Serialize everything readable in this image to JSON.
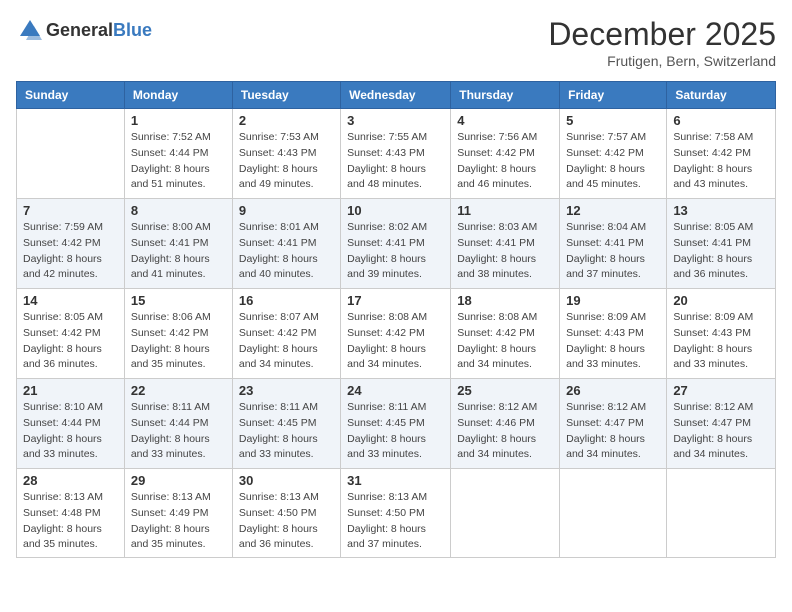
{
  "header": {
    "logo_general": "General",
    "logo_blue": "Blue",
    "month": "December 2025",
    "location": "Frutigen, Bern, Switzerland"
  },
  "days_of_week": [
    "Sunday",
    "Monday",
    "Tuesday",
    "Wednesday",
    "Thursday",
    "Friday",
    "Saturday"
  ],
  "weeks": [
    [
      {
        "day": null,
        "sunrise": null,
        "sunset": null,
        "daylight": null
      },
      {
        "day": "1",
        "sunrise": "Sunrise: 7:52 AM",
        "sunset": "Sunset: 4:44 PM",
        "daylight": "Daylight: 8 hours and 51 minutes."
      },
      {
        "day": "2",
        "sunrise": "Sunrise: 7:53 AM",
        "sunset": "Sunset: 4:43 PM",
        "daylight": "Daylight: 8 hours and 49 minutes."
      },
      {
        "day": "3",
        "sunrise": "Sunrise: 7:55 AM",
        "sunset": "Sunset: 4:43 PM",
        "daylight": "Daylight: 8 hours and 48 minutes."
      },
      {
        "day": "4",
        "sunrise": "Sunrise: 7:56 AM",
        "sunset": "Sunset: 4:42 PM",
        "daylight": "Daylight: 8 hours and 46 minutes."
      },
      {
        "day": "5",
        "sunrise": "Sunrise: 7:57 AM",
        "sunset": "Sunset: 4:42 PM",
        "daylight": "Daylight: 8 hours and 45 minutes."
      },
      {
        "day": "6",
        "sunrise": "Sunrise: 7:58 AM",
        "sunset": "Sunset: 4:42 PM",
        "daylight": "Daylight: 8 hours and 43 minutes."
      }
    ],
    [
      {
        "day": "7",
        "sunrise": "Sunrise: 7:59 AM",
        "sunset": "Sunset: 4:42 PM",
        "daylight": "Daylight: 8 hours and 42 minutes."
      },
      {
        "day": "8",
        "sunrise": "Sunrise: 8:00 AM",
        "sunset": "Sunset: 4:41 PM",
        "daylight": "Daylight: 8 hours and 41 minutes."
      },
      {
        "day": "9",
        "sunrise": "Sunrise: 8:01 AM",
        "sunset": "Sunset: 4:41 PM",
        "daylight": "Daylight: 8 hours and 40 minutes."
      },
      {
        "day": "10",
        "sunrise": "Sunrise: 8:02 AM",
        "sunset": "Sunset: 4:41 PM",
        "daylight": "Daylight: 8 hours and 39 minutes."
      },
      {
        "day": "11",
        "sunrise": "Sunrise: 8:03 AM",
        "sunset": "Sunset: 4:41 PM",
        "daylight": "Daylight: 8 hours and 38 minutes."
      },
      {
        "day": "12",
        "sunrise": "Sunrise: 8:04 AM",
        "sunset": "Sunset: 4:41 PM",
        "daylight": "Daylight: 8 hours and 37 minutes."
      },
      {
        "day": "13",
        "sunrise": "Sunrise: 8:05 AM",
        "sunset": "Sunset: 4:41 PM",
        "daylight": "Daylight: 8 hours and 36 minutes."
      }
    ],
    [
      {
        "day": "14",
        "sunrise": "Sunrise: 8:05 AM",
        "sunset": "Sunset: 4:42 PM",
        "daylight": "Daylight: 8 hours and 36 minutes."
      },
      {
        "day": "15",
        "sunrise": "Sunrise: 8:06 AM",
        "sunset": "Sunset: 4:42 PM",
        "daylight": "Daylight: 8 hours and 35 minutes."
      },
      {
        "day": "16",
        "sunrise": "Sunrise: 8:07 AM",
        "sunset": "Sunset: 4:42 PM",
        "daylight": "Daylight: 8 hours and 34 minutes."
      },
      {
        "day": "17",
        "sunrise": "Sunrise: 8:08 AM",
        "sunset": "Sunset: 4:42 PM",
        "daylight": "Daylight: 8 hours and 34 minutes."
      },
      {
        "day": "18",
        "sunrise": "Sunrise: 8:08 AM",
        "sunset": "Sunset: 4:42 PM",
        "daylight": "Daylight: 8 hours and 34 minutes."
      },
      {
        "day": "19",
        "sunrise": "Sunrise: 8:09 AM",
        "sunset": "Sunset: 4:43 PM",
        "daylight": "Daylight: 8 hours and 33 minutes."
      },
      {
        "day": "20",
        "sunrise": "Sunrise: 8:09 AM",
        "sunset": "Sunset: 4:43 PM",
        "daylight": "Daylight: 8 hours and 33 minutes."
      }
    ],
    [
      {
        "day": "21",
        "sunrise": "Sunrise: 8:10 AM",
        "sunset": "Sunset: 4:44 PM",
        "daylight": "Daylight: 8 hours and 33 minutes."
      },
      {
        "day": "22",
        "sunrise": "Sunrise: 8:11 AM",
        "sunset": "Sunset: 4:44 PM",
        "daylight": "Daylight: 8 hours and 33 minutes."
      },
      {
        "day": "23",
        "sunrise": "Sunrise: 8:11 AM",
        "sunset": "Sunset: 4:45 PM",
        "daylight": "Daylight: 8 hours and 33 minutes."
      },
      {
        "day": "24",
        "sunrise": "Sunrise: 8:11 AM",
        "sunset": "Sunset: 4:45 PM",
        "daylight": "Daylight: 8 hours and 33 minutes."
      },
      {
        "day": "25",
        "sunrise": "Sunrise: 8:12 AM",
        "sunset": "Sunset: 4:46 PM",
        "daylight": "Daylight: 8 hours and 34 minutes."
      },
      {
        "day": "26",
        "sunrise": "Sunrise: 8:12 AM",
        "sunset": "Sunset: 4:47 PM",
        "daylight": "Daylight: 8 hours and 34 minutes."
      },
      {
        "day": "27",
        "sunrise": "Sunrise: 8:12 AM",
        "sunset": "Sunset: 4:47 PM",
        "daylight": "Daylight: 8 hours and 34 minutes."
      }
    ],
    [
      {
        "day": "28",
        "sunrise": "Sunrise: 8:13 AM",
        "sunset": "Sunset: 4:48 PM",
        "daylight": "Daylight: 8 hours and 35 minutes."
      },
      {
        "day": "29",
        "sunrise": "Sunrise: 8:13 AM",
        "sunset": "Sunset: 4:49 PM",
        "daylight": "Daylight: 8 hours and 35 minutes."
      },
      {
        "day": "30",
        "sunrise": "Sunrise: 8:13 AM",
        "sunset": "Sunset: 4:50 PM",
        "daylight": "Daylight: 8 hours and 36 minutes."
      },
      {
        "day": "31",
        "sunrise": "Sunrise: 8:13 AM",
        "sunset": "Sunset: 4:50 PM",
        "daylight": "Daylight: 8 hours and 37 minutes."
      },
      {
        "day": null,
        "sunrise": null,
        "sunset": null,
        "daylight": null
      },
      {
        "day": null,
        "sunrise": null,
        "sunset": null,
        "daylight": null
      },
      {
        "day": null,
        "sunrise": null,
        "sunset": null,
        "daylight": null
      }
    ]
  ]
}
